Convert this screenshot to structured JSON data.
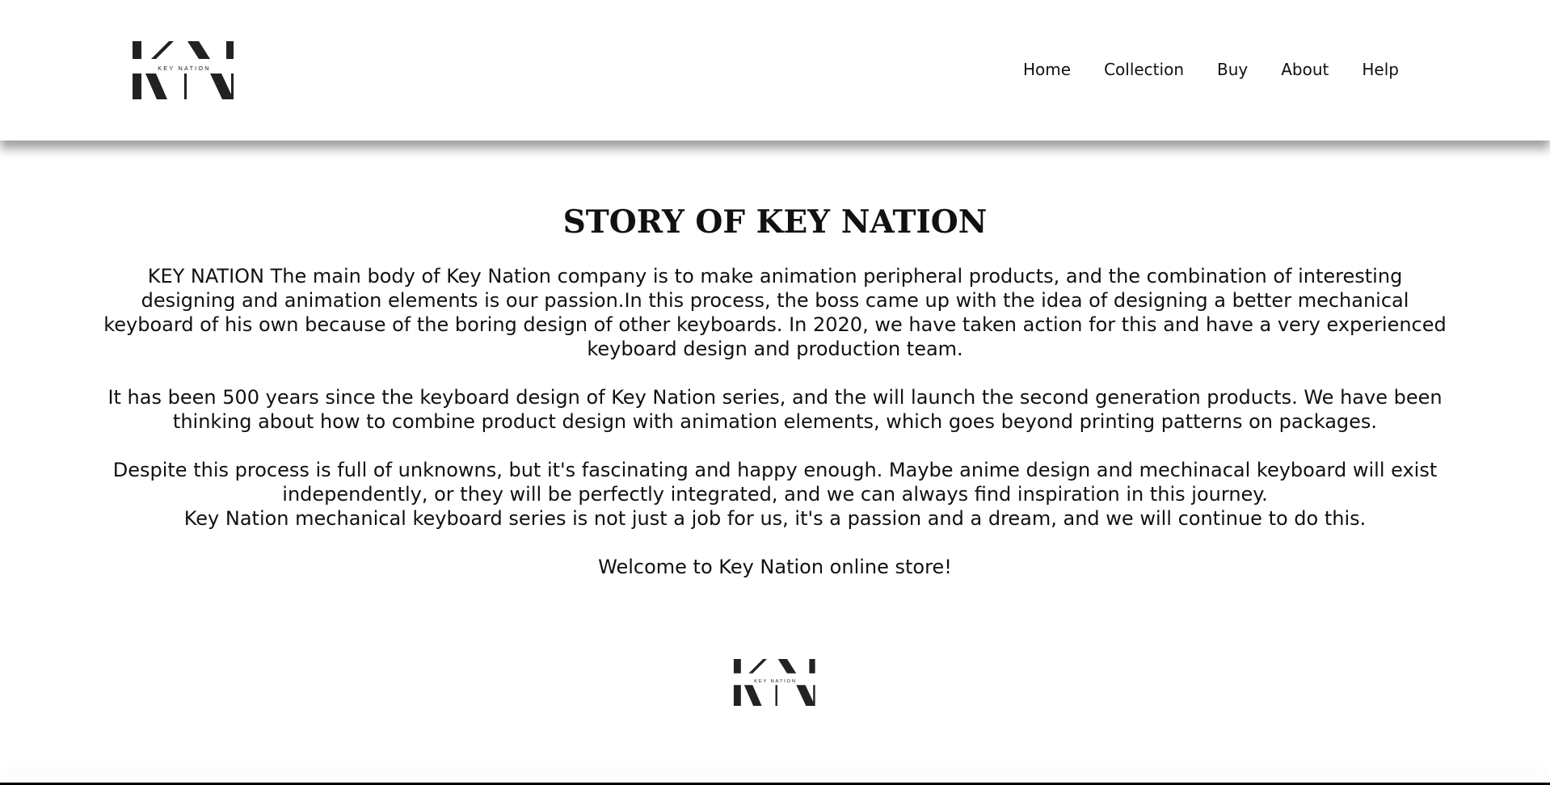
{
  "header": {
    "logo": {
      "text": "KEY NATION"
    },
    "nav": {
      "home": "Home",
      "collection": "Collection",
      "buy": "Buy",
      "about": "About",
      "help": "Help"
    }
  },
  "main": {
    "title": "STORY OF KEY NATION",
    "paragraphs": {
      "p1": "KEY NATION The main body of Key Nation company is to make animation peripheral products, and the combination of interesting designing and animation elements is our passion.In this process, the boss came up with the idea of designing a better mechanical keyboard of his own because of the boring design of other keyboards. In 2020, we have taken action for this and have a very experienced keyboard design and production team.",
      "p2": "It has been 500 years since the keyboard design of Key Nation series, and the will launch the second generation products. We have been thinking about how to combine product design with animation elements, which goes beyond printing patterns on packages.",
      "p3": "Despite this process is full of unknowns, but it's fascinating and happy enough. Maybe anime design and mechinacal keyboard will exist independently, or they will be perfectly integrated, and we can always find inspiration in this journey.",
      "p4": "Key Nation mechanical keyboard series is not just a job for us, it's a passion and a dream, and we will continue to do this.",
      "p5": "Welcome to Key Nation online store!"
    },
    "footer_logo": {
      "text": "KEY NATION"
    }
  },
  "colors": {
    "text": "#111111",
    "background": "#ffffff",
    "logo": "#222222"
  },
  "icons": {
    "logo": "key-nation-logo-icon"
  }
}
